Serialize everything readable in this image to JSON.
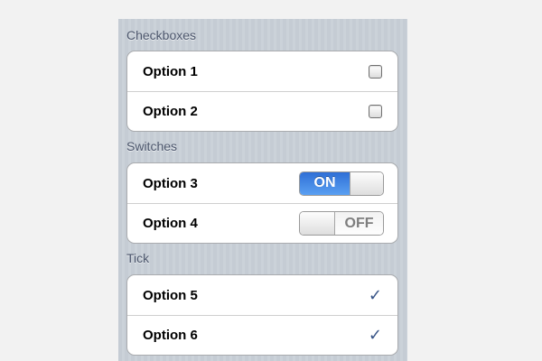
{
  "sections": [
    {
      "title": "Checkboxes",
      "items": [
        {
          "label": "Option 1",
          "checked": false
        },
        {
          "label": "Option 2",
          "checked": false
        }
      ]
    },
    {
      "title": "Switches",
      "items": [
        {
          "label": "Option 3",
          "state": "ON"
        },
        {
          "label": "Option 4",
          "state": "OFF"
        }
      ]
    },
    {
      "title": "Tick",
      "items": [
        {
          "label": "Option 5",
          "tick": "✓",
          "icon": "checkmark-icon"
        },
        {
          "label": "Option 6",
          "tick": "✓",
          "icon": "checkmark-icon"
        }
      ]
    }
  ],
  "colors": {
    "panel_bg": "#c5ccd4",
    "switch_on": "#3d7fe0",
    "tick": "#385487",
    "section_title": "#4c566c"
  }
}
